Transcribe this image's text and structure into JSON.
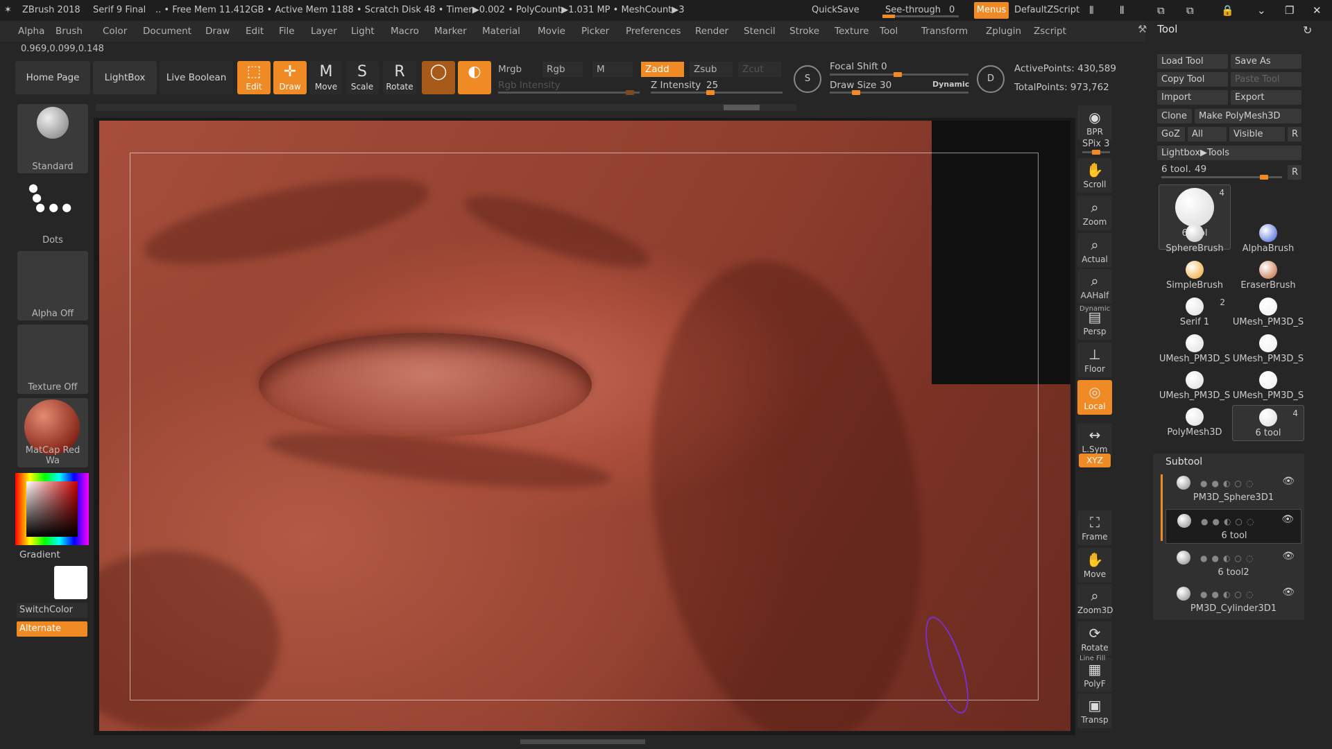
{
  "titlebar": {
    "app": "ZBrush 2018",
    "doc": "Serif 9 Final",
    "stats": ".. • Free Mem 11.412GB • Active Mem 1188 • Scratch Disk 48 • Timer▶0.002 • PolyCount▶1.031 MP • MeshCount▶3",
    "quicksave": "QuickSave",
    "see_through": "See-through",
    "see_through_value": "0",
    "menus": "Menus",
    "script": "DefaultZScript",
    "accent": "#f08a24"
  },
  "menubar": [
    "Alpha",
    "Brush",
    "Color",
    "Document",
    "Draw",
    "Edit",
    "File",
    "Layer",
    "Light",
    "Macro",
    "Marker",
    "Material",
    "Movie",
    "Picker",
    "Preferences",
    "Render",
    "Stencil",
    "Stroke",
    "Texture",
    "Tool",
    "Transform",
    "Zplugin",
    "Zscript"
  ],
  "coords": "0.969,0.099,0.148",
  "shelf": {
    "home": "Home Page",
    "lightbox": "LightBox",
    "live_boolean": "Live Boolean",
    "edit": "Edit",
    "draw": "Draw",
    "move": "Move",
    "scale": "Scale",
    "rotate": "Rotate",
    "mrgb": "Mrgb",
    "rgb": "Rgb",
    "m": "M",
    "zadd": "Zadd",
    "zsub": "Zsub",
    "zcut": "Zcut",
    "rgb_intensity": "Rgb Intensity",
    "z_intensity_label": "Z Intensity",
    "z_intensity": "25",
    "focal_shift_label": "Focal Shift",
    "focal_shift": "0",
    "draw_size_label": "Draw Size",
    "draw_size": "30",
    "dynamic": "Dynamic",
    "active_points": "ActivePoints: 430,589",
    "total_points": "TotalPoints: 973,762",
    "icon_s": "S",
    "icon_d": "D"
  },
  "left": {
    "brush": "Standard",
    "stroke": "Dots",
    "alpha": "Alpha Off",
    "texture": "Texture Off",
    "material": "MatCap Red Wa",
    "gradient": "Gradient",
    "switch_color": "SwitchColor",
    "alternate": "Alternate"
  },
  "right_strip": [
    "BPR",
    "SPix 3",
    "Scroll",
    "Zoom",
    "Actual",
    "AAHalf",
    "Persp",
    "Floor",
    "Local",
    "L.Sym",
    "Frame",
    "Move",
    "Zoom3D",
    "Rotate",
    "PolyF",
    "Transp"
  ],
  "strip_extra": {
    "xyz": "XYZ",
    "dynamic": "Dynamic",
    "line_fill": "Line Fill"
  },
  "tool_panel": {
    "title": "Tool",
    "load": "Load Tool",
    "save_as": "Save As",
    "copy": "Copy Tool",
    "paste": "Paste Tool",
    "import": "Import",
    "export": "Export",
    "clone": "Clone",
    "make_poly": "Make PolyMesh3D",
    "goz": "GoZ",
    "all": "All",
    "visible": "Visible",
    "r": "R",
    "lightbox_tools": "Lightbox▶Tools",
    "slider_label": "6 tool.",
    "slider_value": "49",
    "tools": [
      {
        "name": "6 tool",
        "count": "4"
      },
      {
        "name": "SphereBrush",
        "count": ""
      },
      {
        "name": "AlphaBrush",
        "count": ""
      },
      {
        "name": "SimpleBrush",
        "count": ""
      },
      {
        "name": "EraserBrush",
        "count": ""
      },
      {
        "name": "Serif 1",
        "count": "2"
      },
      {
        "name": "UMesh_PM3D_S",
        "count": ""
      },
      {
        "name": "UMesh_PM3D_S",
        "count": ""
      },
      {
        "name": "UMesh_PM3D_S",
        "count": ""
      },
      {
        "name": "UMesh_PM3D_S",
        "count": ""
      },
      {
        "name": "UMesh_PM3D_S",
        "count": ""
      },
      {
        "name": "PolyMesh3D",
        "count": ""
      },
      {
        "name": "6 tool",
        "count": "4"
      }
    ],
    "subtool_title": "Subtool",
    "subtools": [
      "PM3D_Sphere3D1",
      "6 tool",
      "6 tool2",
      "PM3D_Cylinder3D1"
    ]
  }
}
